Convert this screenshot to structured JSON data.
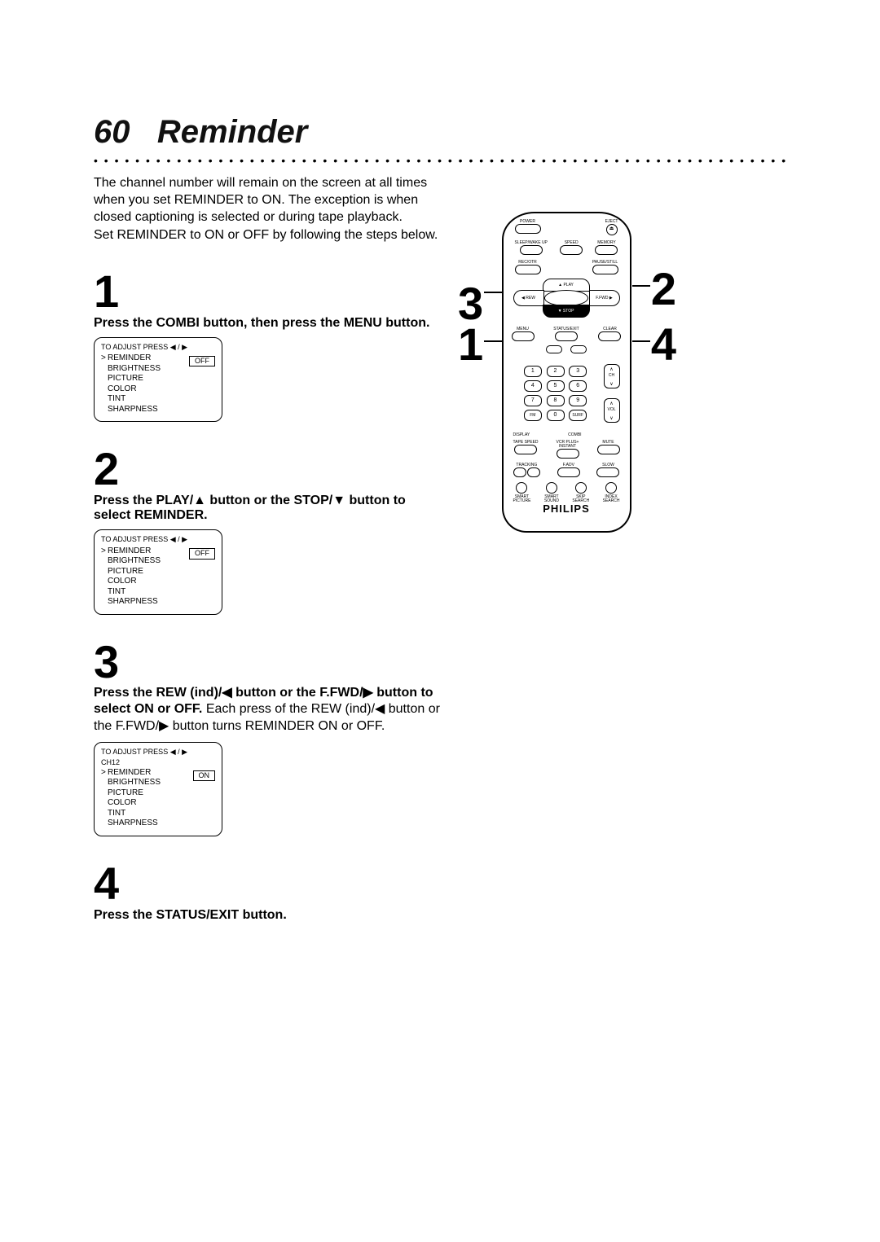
{
  "page": {
    "number": "60",
    "title": "Reminder",
    "intro_p1": "The channel number will remain on the screen at all times when you set REMINDER to ON. The exception is when closed captioning is selected or during tape playback.",
    "intro_p2": "Set REMINDER to ON or OFF by following the steps below."
  },
  "steps": {
    "s1": {
      "num": "1",
      "line": "Press the COMBI button, then press the MENU button."
    },
    "s2": {
      "num": "2",
      "line": "Press the PLAY/▲ button or the STOP/▼ button to select REMINDER."
    },
    "s3": {
      "num": "3",
      "bold": "Press the REW (ind)/◀ button or the F.FWD/▶ button to select ON or OFF.",
      "rest": " Each press of the REW (ind)/◀ button or the F.FWD/▶ button turns REMINDER ON or OFF."
    },
    "s4": {
      "num": "4",
      "line": "Press the STATUS/EXIT button."
    }
  },
  "osd": {
    "head": "TO ADJUST PRESS ◀ / ▶",
    "ch": "CH12",
    "items": [
      "REMINDER",
      "BRIGHTNESS",
      "PICTURE",
      "COLOR",
      "TINT",
      "SHARPNESS"
    ],
    "off": "OFF",
    "on": "ON"
  },
  "remote": {
    "brand": "PHILIPS",
    "labels": {
      "power": "POWER",
      "eject": "EJECT",
      "sleep": "SLEEP/WAKE UP",
      "speed": "SPEED",
      "memory": "MEMORY",
      "recotr": "REC/OTR",
      "pause": "PAUSE/STILL",
      "play": "PLAY",
      "rew": "REW",
      "ffwd": "F.FWD",
      "stop": "STOP",
      "menu": "MENU",
      "status": "STATUS/EXIT",
      "clear": "CLEAR",
      "ch": "CH",
      "vol": "VOL",
      "fm": "FM",
      "surf": "SURF",
      "display": "DISPLAY",
      "combi": "COMBI",
      "tapespd": "TAPE SPEED",
      "vcr": "VCR PLUS+\nINSTANT",
      "mute": "MUTE",
      "tracking": "TRACKING",
      "fadv": "F.ADV",
      "slow": "SLOW",
      "smart": "SMART\nPICTURE",
      "sound": "SMART\nSOUND",
      "skip": "SKIP\nSEARCH",
      "index": "INDEX\nSEARCH"
    },
    "keys": [
      "1",
      "2",
      "3",
      "4",
      "5",
      "6",
      "7",
      "8",
      "9",
      "FM",
      "0",
      "SURF"
    ]
  },
  "callouts": {
    "c1": "1",
    "c2": "2",
    "c3": "3",
    "c4": "4"
  }
}
